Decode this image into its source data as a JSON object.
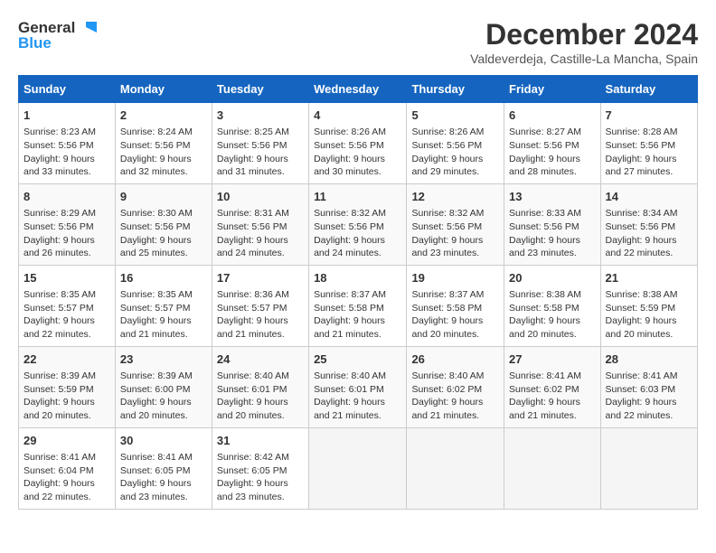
{
  "header": {
    "logo_line1": "General",
    "logo_line2": "Blue",
    "month": "December 2024",
    "location": "Valdeverdeja, Castille-La Mancha, Spain"
  },
  "days_of_week": [
    "Sunday",
    "Monday",
    "Tuesday",
    "Wednesday",
    "Thursday",
    "Friday",
    "Saturday"
  ],
  "weeks": [
    [
      {
        "day": "1",
        "sunrise": "Sunrise: 8:23 AM",
        "sunset": "Sunset: 5:56 PM",
        "daylight": "Daylight: 9 hours and 33 minutes."
      },
      {
        "day": "2",
        "sunrise": "Sunrise: 8:24 AM",
        "sunset": "Sunset: 5:56 PM",
        "daylight": "Daylight: 9 hours and 32 minutes."
      },
      {
        "day": "3",
        "sunrise": "Sunrise: 8:25 AM",
        "sunset": "Sunset: 5:56 PM",
        "daylight": "Daylight: 9 hours and 31 minutes."
      },
      {
        "day": "4",
        "sunrise": "Sunrise: 8:26 AM",
        "sunset": "Sunset: 5:56 PM",
        "daylight": "Daylight: 9 hours and 30 minutes."
      },
      {
        "day": "5",
        "sunrise": "Sunrise: 8:26 AM",
        "sunset": "Sunset: 5:56 PM",
        "daylight": "Daylight: 9 hours and 29 minutes."
      },
      {
        "day": "6",
        "sunrise": "Sunrise: 8:27 AM",
        "sunset": "Sunset: 5:56 PM",
        "daylight": "Daylight: 9 hours and 28 minutes."
      },
      {
        "day": "7",
        "sunrise": "Sunrise: 8:28 AM",
        "sunset": "Sunset: 5:56 PM",
        "daylight": "Daylight: 9 hours and 27 minutes."
      }
    ],
    [
      {
        "day": "8",
        "sunrise": "Sunrise: 8:29 AM",
        "sunset": "Sunset: 5:56 PM",
        "daylight": "Daylight: 9 hours and 26 minutes."
      },
      {
        "day": "9",
        "sunrise": "Sunrise: 8:30 AM",
        "sunset": "Sunset: 5:56 PM",
        "daylight": "Daylight: 9 hours and 25 minutes."
      },
      {
        "day": "10",
        "sunrise": "Sunrise: 8:31 AM",
        "sunset": "Sunset: 5:56 PM",
        "daylight": "Daylight: 9 hours and 24 minutes."
      },
      {
        "day": "11",
        "sunrise": "Sunrise: 8:32 AM",
        "sunset": "Sunset: 5:56 PM",
        "daylight": "Daylight: 9 hours and 24 minutes."
      },
      {
        "day": "12",
        "sunrise": "Sunrise: 8:32 AM",
        "sunset": "Sunset: 5:56 PM",
        "daylight": "Daylight: 9 hours and 23 minutes."
      },
      {
        "day": "13",
        "sunrise": "Sunrise: 8:33 AM",
        "sunset": "Sunset: 5:56 PM",
        "daylight": "Daylight: 9 hours and 23 minutes."
      },
      {
        "day": "14",
        "sunrise": "Sunrise: 8:34 AM",
        "sunset": "Sunset: 5:56 PM",
        "daylight": "Daylight: 9 hours and 22 minutes."
      }
    ],
    [
      {
        "day": "15",
        "sunrise": "Sunrise: 8:35 AM",
        "sunset": "Sunset: 5:57 PM",
        "daylight": "Daylight: 9 hours and 22 minutes."
      },
      {
        "day": "16",
        "sunrise": "Sunrise: 8:35 AM",
        "sunset": "Sunset: 5:57 PM",
        "daylight": "Daylight: 9 hours and 21 minutes."
      },
      {
        "day": "17",
        "sunrise": "Sunrise: 8:36 AM",
        "sunset": "Sunset: 5:57 PM",
        "daylight": "Daylight: 9 hours and 21 minutes."
      },
      {
        "day": "18",
        "sunrise": "Sunrise: 8:37 AM",
        "sunset": "Sunset: 5:58 PM",
        "daylight": "Daylight: 9 hours and 21 minutes."
      },
      {
        "day": "19",
        "sunrise": "Sunrise: 8:37 AM",
        "sunset": "Sunset: 5:58 PM",
        "daylight": "Daylight: 9 hours and 20 minutes."
      },
      {
        "day": "20",
        "sunrise": "Sunrise: 8:38 AM",
        "sunset": "Sunset: 5:58 PM",
        "daylight": "Daylight: 9 hours and 20 minutes."
      },
      {
        "day": "21",
        "sunrise": "Sunrise: 8:38 AM",
        "sunset": "Sunset: 5:59 PM",
        "daylight": "Daylight: 9 hours and 20 minutes."
      }
    ],
    [
      {
        "day": "22",
        "sunrise": "Sunrise: 8:39 AM",
        "sunset": "Sunset: 5:59 PM",
        "daylight": "Daylight: 9 hours and 20 minutes."
      },
      {
        "day": "23",
        "sunrise": "Sunrise: 8:39 AM",
        "sunset": "Sunset: 6:00 PM",
        "daylight": "Daylight: 9 hours and 20 minutes."
      },
      {
        "day": "24",
        "sunrise": "Sunrise: 8:40 AM",
        "sunset": "Sunset: 6:01 PM",
        "daylight": "Daylight: 9 hours and 20 minutes."
      },
      {
        "day": "25",
        "sunrise": "Sunrise: 8:40 AM",
        "sunset": "Sunset: 6:01 PM",
        "daylight": "Daylight: 9 hours and 21 minutes."
      },
      {
        "day": "26",
        "sunrise": "Sunrise: 8:40 AM",
        "sunset": "Sunset: 6:02 PM",
        "daylight": "Daylight: 9 hours and 21 minutes."
      },
      {
        "day": "27",
        "sunrise": "Sunrise: 8:41 AM",
        "sunset": "Sunset: 6:02 PM",
        "daylight": "Daylight: 9 hours and 21 minutes."
      },
      {
        "day": "28",
        "sunrise": "Sunrise: 8:41 AM",
        "sunset": "Sunset: 6:03 PM",
        "daylight": "Daylight: 9 hours and 22 minutes."
      }
    ],
    [
      {
        "day": "29",
        "sunrise": "Sunrise: 8:41 AM",
        "sunset": "Sunset: 6:04 PM",
        "daylight": "Daylight: 9 hours and 22 minutes."
      },
      {
        "day": "30",
        "sunrise": "Sunrise: 8:41 AM",
        "sunset": "Sunset: 6:05 PM",
        "daylight": "Daylight: 9 hours and 23 minutes."
      },
      {
        "day": "31",
        "sunrise": "Sunrise: 8:42 AM",
        "sunset": "Sunset: 6:05 PM",
        "daylight": "Daylight: 9 hours and 23 minutes."
      },
      null,
      null,
      null,
      null
    ]
  ]
}
